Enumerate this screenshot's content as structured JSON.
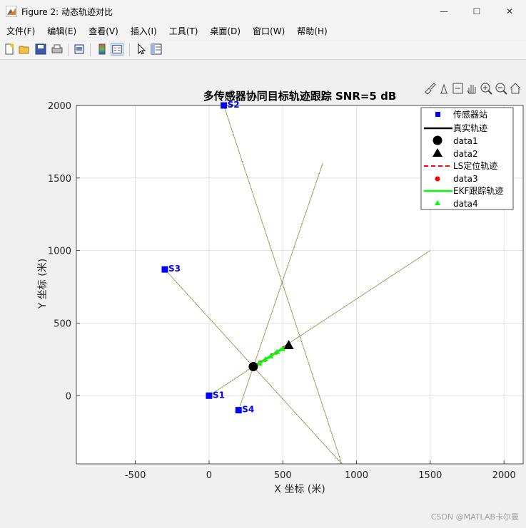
{
  "window": {
    "title": "Figure 2: 动态轨迹对比",
    "minimize": "—",
    "maximize": "☐",
    "close": "✕"
  },
  "menu": [
    "文件(F)",
    "编辑(E)",
    "查看(V)",
    "插入(I)",
    "工具(T)",
    "桌面(D)",
    "窗口(W)",
    "帮助(H)"
  ],
  "toolbar_icons": [
    "new-figure-icon",
    "open-file-icon",
    "save-icon",
    "print-icon",
    "print-preview-icon",
    "colorbar-icon",
    "legend-icon",
    "pointer-icon",
    "property-editor-icon"
  ],
  "axes_toolbar_icons": [
    "brush-icon",
    "data-tips-icon",
    "export-icon",
    "pan-icon",
    "zoom-in-icon",
    "zoom-out-icon",
    "home-icon"
  ],
  "watermark": "CSDN @MATLAB卡尔曼",
  "chart_data": {
    "type": "scatter",
    "title": "多传感器协同目标轨迹跟踪  SNR=5 dB",
    "xlabel": "X 坐标 (米)",
    "ylabel": "Y 坐标 (米)",
    "xlim": [
      -900,
      2130
    ],
    "ylim": [
      -470,
      2000
    ],
    "xticks": [
      -500,
      0,
      500,
      1000,
      1500,
      2000
    ],
    "yticks": [
      0,
      500,
      1000,
      1500,
      2000
    ],
    "xticklabels": [
      "-500",
      "0",
      "500",
      "1000",
      "1500",
      "2000"
    ],
    "yticklabels": [
      "0",
      "500",
      "1000",
      "1500",
      "2000"
    ],
    "grid": true,
    "legend_position": "top-right",
    "colors": {
      "sensor": "#0000ff",
      "true": "#000000",
      "ls": "#ff0000",
      "ekf": "#00ff00",
      "los": "#00aa00"
    },
    "sensors": [
      {
        "label": "S1",
        "x": 0,
        "y": 0
      },
      {
        "label": "S2",
        "x": 100,
        "y": 2000
      },
      {
        "label": "S3",
        "x": -300,
        "y": 870
      },
      {
        "label": "S4",
        "x": 200,
        "y": -100
      }
    ],
    "los_lines": [
      {
        "x1": 0,
        "y1": 0,
        "x2": 1500,
        "y2": 1000
      },
      {
        "x1": 100,
        "y1": 2000,
        "x2": 900,
        "y2": -470
      },
      {
        "x1": -300,
        "y1": 870,
        "x2": 900,
        "y2": -470
      },
      {
        "x1": 200,
        "y1": -100,
        "x2": 770,
        "y2": 1600
      }
    ],
    "true_track": {
      "x": [
        300,
        340,
        380,
        420,
        460,
        500,
        530
      ],
      "y": [
        200,
        225,
        250,
        275,
        300,
        325,
        345
      ]
    },
    "ls_track": {
      "x": [
        300,
        345,
        380,
        425,
        455,
        505,
        525
      ],
      "y": [
        195,
        230,
        245,
        280,
        295,
        330,
        340
      ]
    },
    "ekf_track": {
      "x": [
        300,
        342,
        382,
        418,
        462,
        498,
        528
      ],
      "y": [
        200,
        222,
        252,
        272,
        302,
        322,
        342
      ]
    },
    "start_point": {
      "x": 300,
      "y": 200
    },
    "end_point": {
      "x": 540,
      "y": 350
    },
    "legend": [
      "传感器站",
      "真实轨迹",
      "data1",
      "data2",
      "LS定位轨迹",
      "data3",
      "EKF跟踪轨迹",
      "data4"
    ]
  }
}
